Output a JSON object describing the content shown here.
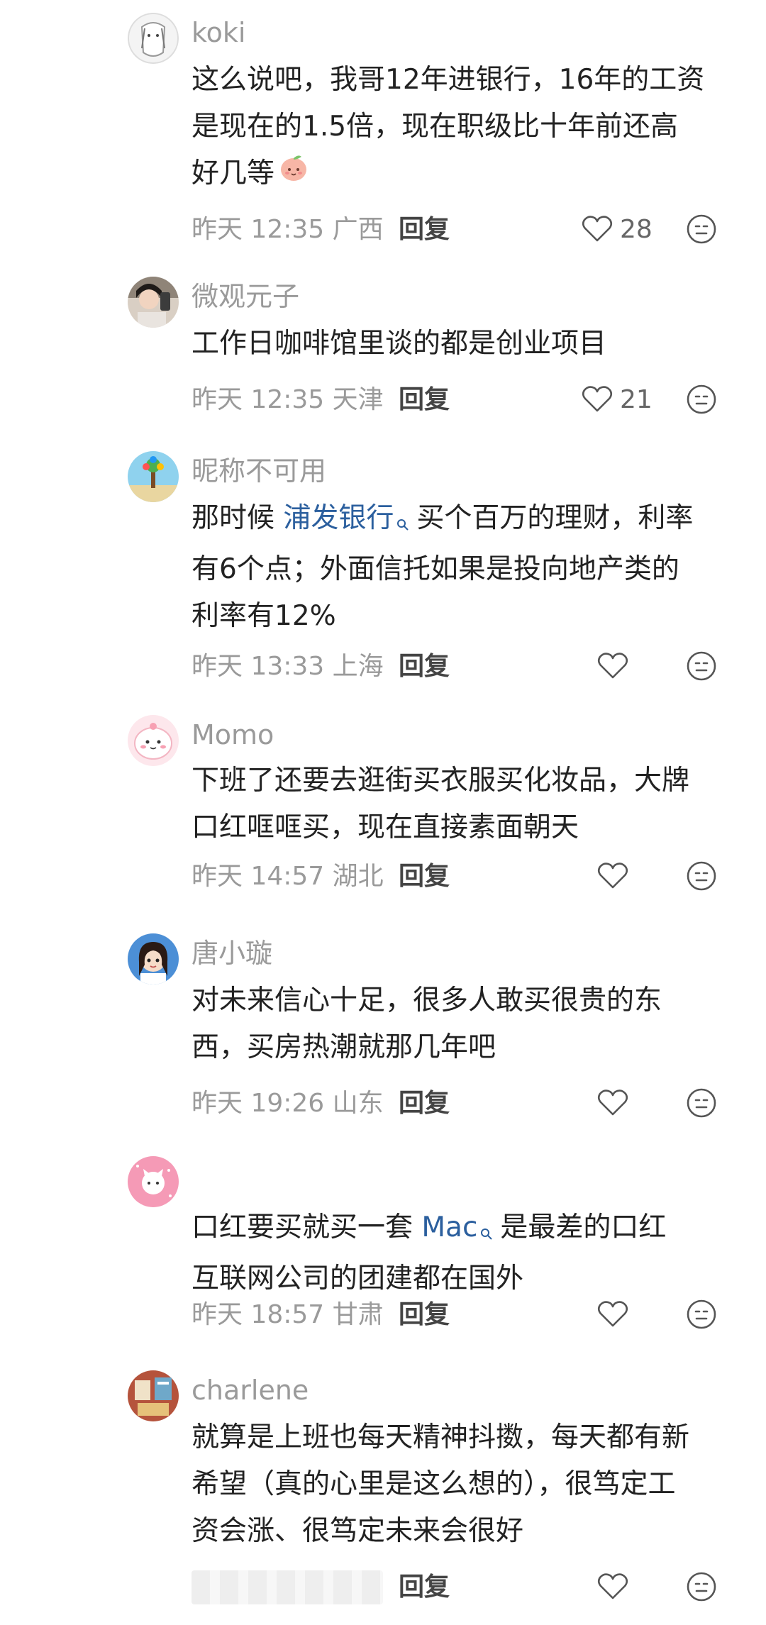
{
  "actions": {
    "reply_label": "回复"
  },
  "comments": [
    {
      "username": "koki",
      "lines": [
        "这么说吧，我哥12年进银行，16年的工资",
        "是现在的1.5倍，现在职级比十年前还高",
        "好几等"
      ],
      "emoji": "peach-face-emoji",
      "meta": "昨天 12:35 广西",
      "likes": "28"
    },
    {
      "username": "微观元子",
      "lines": [
        "工作日咖啡馆里谈的都是创业项目"
      ],
      "meta": "昨天 12:35 天津",
      "likes": "21"
    },
    {
      "username": "昵称不可用",
      "line1_prefix": "那时候 ",
      "line1_link": "浦发银行",
      "line1_suffix": "买个百万的理财，利率",
      "lines": [
        "有6个点；外面信托如果是投向地产类的",
        "利率有12%"
      ],
      "meta": "昨天 13:33 上海",
      "likes": ""
    },
    {
      "username": "Momo",
      "lines": [
        "下班了还要去逛街买衣服买化妆品，大牌",
        "口红哐哐买，现在直接素面朝天"
      ],
      "meta": "昨天 14:57 湖北",
      "likes": ""
    },
    {
      "username": "唐小璇",
      "lines": [
        "对未来信心十足，很多人敢买很贵的东",
        "西，买房热潮就那几年吧"
      ],
      "meta": "昨天 19:26 山东",
      "likes": ""
    },
    {
      "username": "",
      "line1_prefix": "口红要买就买一套 ",
      "line1_link": "Mac",
      "line1_suffix": "是最差的口红",
      "lines": [
        "互联网公司的团建都在国外"
      ],
      "meta": "昨天 18:57 甘肃",
      "likes": ""
    },
    {
      "username": "charlene",
      "lines": [
        "就算是上班也每天精神抖擞，每天都有新",
        "希望（真的心里是这么想的），很笃定工",
        "资会涨、很笃定未来会很好"
      ],
      "meta": "",
      "likes": ""
    }
  ],
  "colors": {
    "link": "#2b5f9e",
    "username": "#9a9a9a",
    "meta": "#9a9a9a",
    "text": "#222222"
  }
}
